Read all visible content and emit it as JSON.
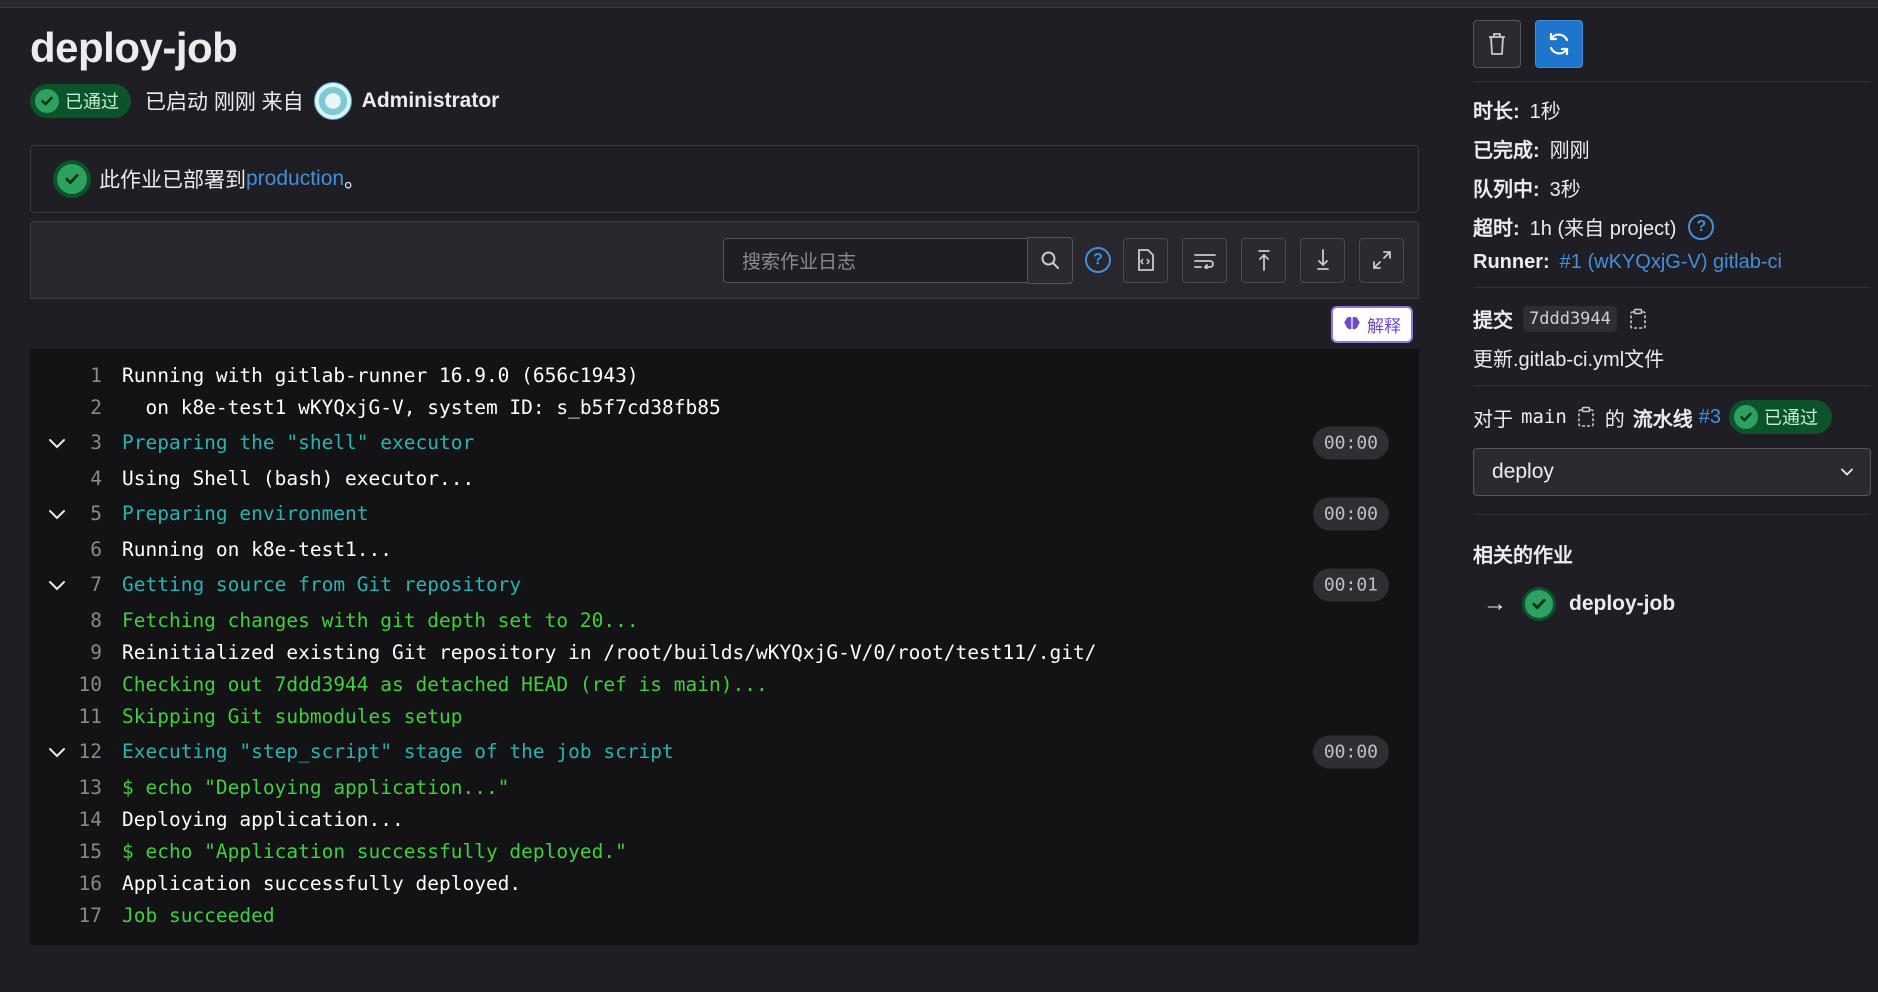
{
  "job": {
    "title": "deploy-job",
    "status_label": "已通过",
    "started_text": "已启动 刚刚 来自",
    "user": "Administrator"
  },
  "alert": {
    "prefix": "此作业已部署到",
    "environment": "production",
    "suffix": "。"
  },
  "log_toolbar": {
    "search_placeholder": "搜索作业日志",
    "help_glyph": "?",
    "explain_label": "解释"
  },
  "log": [
    {
      "n": "1",
      "text": "Running with gitlab-runner 16.9.0 (656c1943)",
      "color": "white"
    },
    {
      "n": "2",
      "text": "  on k8e-test1 wKYQxjG-V, system ID: s_b5f7cd38fb85",
      "color": "white"
    },
    {
      "n": "3",
      "text": "Preparing the \"shell\" executor",
      "color": "cyan",
      "section": true,
      "duration": "00:00"
    },
    {
      "n": "4",
      "text": "Using Shell (bash) executor...",
      "color": "white"
    },
    {
      "n": "5",
      "text": "Preparing environment",
      "color": "cyan",
      "section": true,
      "duration": "00:00"
    },
    {
      "n": "6",
      "text": "Running on k8e-test1...",
      "color": "white"
    },
    {
      "n": "7",
      "text": "Getting source from Git repository",
      "color": "cyan",
      "section": true,
      "duration": "00:01"
    },
    {
      "n": "8",
      "text": "Fetching changes with git depth set to 20...",
      "color": "green"
    },
    {
      "n": "9",
      "text": "Reinitialized existing Git repository in /root/builds/wKYQxjG-V/0/root/test11/.git/",
      "color": "white"
    },
    {
      "n": "10",
      "text": "Checking out 7ddd3944 as detached HEAD (ref is main)...",
      "color": "green"
    },
    {
      "n": "11",
      "text": "Skipping Git submodules setup",
      "color": "green"
    },
    {
      "n": "12",
      "text": "Executing \"step_script\" stage of the job script",
      "color": "cyan",
      "section": true,
      "duration": "00:00"
    },
    {
      "n": "13",
      "text": "$ echo \"Deploying application...\"",
      "color": "green"
    },
    {
      "n": "14",
      "text": "Deploying application...",
      "color": "white"
    },
    {
      "n": "15",
      "text": "$ echo \"Application successfully deployed.\"",
      "color": "green"
    },
    {
      "n": "16",
      "text": "Application successfully deployed.",
      "color": "white"
    },
    {
      "n": "17",
      "text": "Job succeeded",
      "color": "green"
    }
  ],
  "sidebar": {
    "duration_label": "时长:",
    "duration_value": "1秒",
    "finished_label": "已完成:",
    "finished_value": "刚刚",
    "queued_label": "队列中:",
    "queued_value": "3秒",
    "timeout_label": "超时:",
    "timeout_value": "1h (来自 project)",
    "runner_label": "Runner:",
    "runner_value": "#1 (wKYQxjG-V) gitlab-ci",
    "commit_label": "提交",
    "commit_sha": "7ddd3944",
    "commit_message": "更新.gitlab-ci.yml文件",
    "pipeline_for": "对于",
    "branch": "main",
    "pipeline_of": "的",
    "pipeline_word": "流水线",
    "pipeline_id": "#3",
    "pipeline_status": "已通过",
    "stage_selected": "deploy",
    "related_title": "相关的作业",
    "related_arrow": "→",
    "related_job": "deploy-job"
  },
  "colors": {
    "background": "#1f1e24",
    "log_background": "#131316",
    "link": "#428fdc",
    "success": "#2da160",
    "log_cyan": "#2ab2b3",
    "log_green": "#3fcf3f"
  }
}
